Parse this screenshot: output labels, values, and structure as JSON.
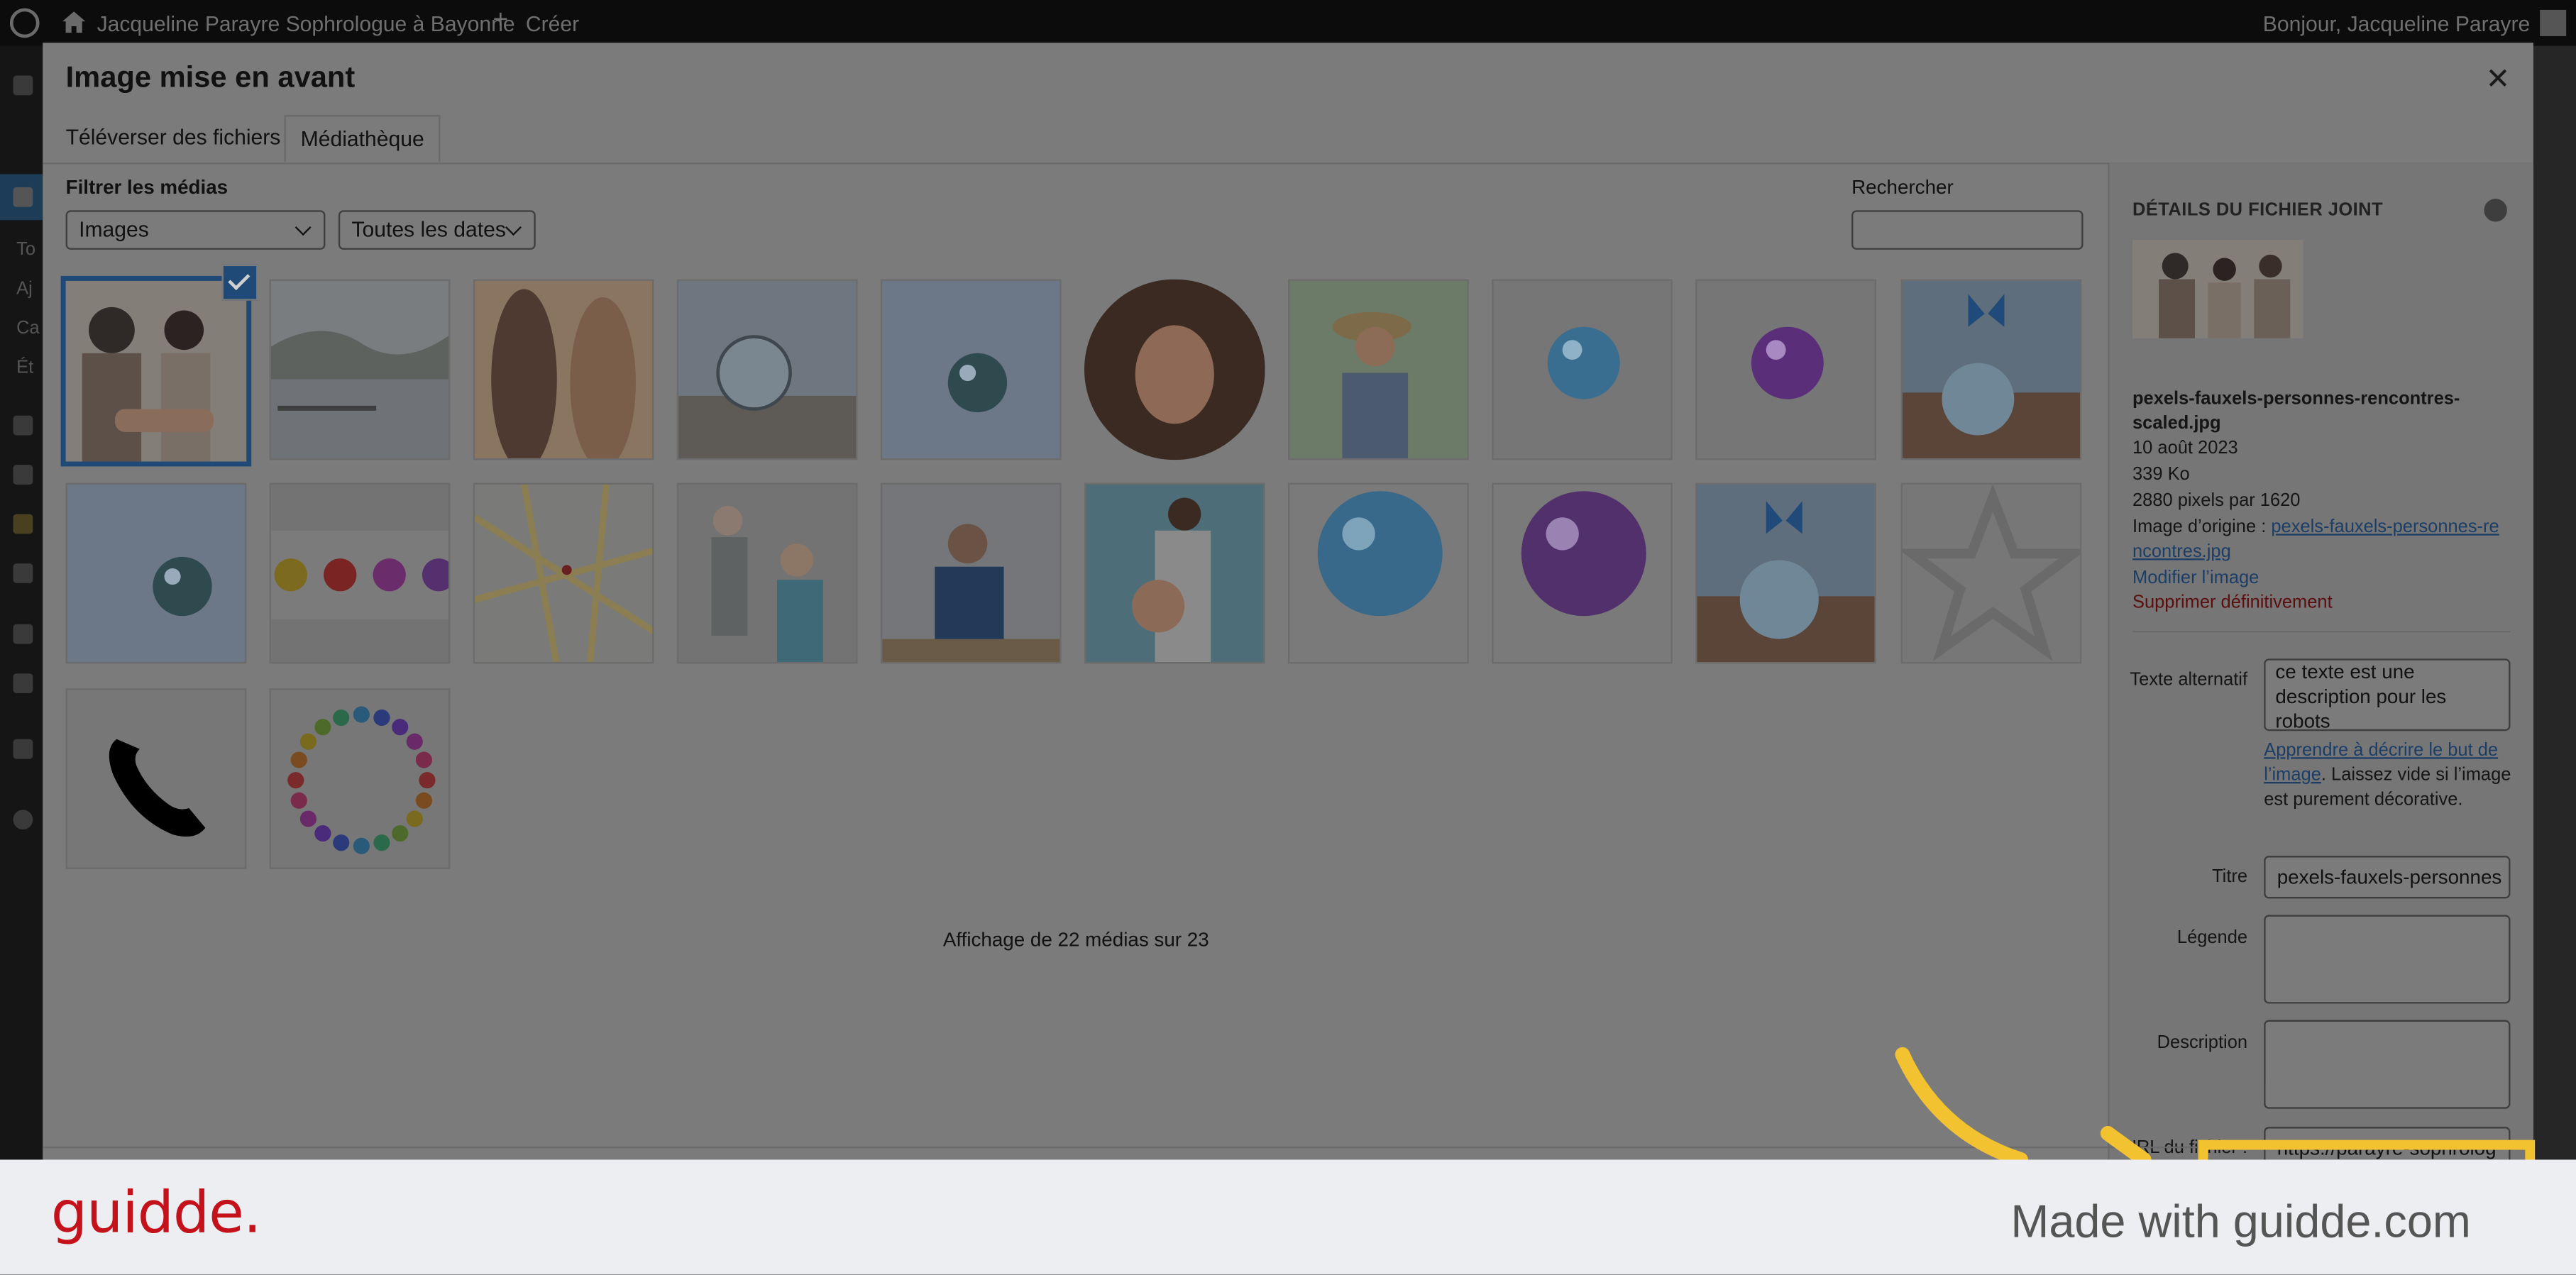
{
  "admin_bar": {
    "site_name": "Jacqueline Parayre Sophrologue à Bayonne",
    "create_label": "Créer",
    "greeting": "Bonjour, Jacqueline Parayre"
  },
  "side_menu": {
    "items": [
      "To",
      "Aj",
      "Ca",
      "Ét"
    ]
  },
  "modal": {
    "title": "Image mise en avant",
    "close_icon": "close-icon",
    "tabs": [
      {
        "label": "Téléverser des fichiers",
        "active": false
      },
      {
        "label": "Médiathèque",
        "active": true
      }
    ]
  },
  "filters": {
    "label": "Filtrer les médias",
    "type_value": "Images",
    "date_value": "Toutes les dates",
    "search_label": "Rechercher",
    "search_value": ""
  },
  "media_grid": {
    "items": [
      {
        "kind": "people-meeting",
        "selected": true
      },
      {
        "kind": "rowing-lake"
      },
      {
        "kind": "women-sunset"
      },
      {
        "kind": "crystal-ball-beach"
      },
      {
        "kind": "crystal-ball-feather"
      },
      {
        "kind": "portrait-woman"
      },
      {
        "kind": "woman-hat"
      },
      {
        "kind": "blue-bubble"
      },
      {
        "kind": "purple-bubble"
      },
      {
        "kind": "butterfly-sphere"
      },
      {
        "kind": "crystal-ball-feather-2"
      },
      {
        "kind": "bubbles-row"
      },
      {
        "kind": "street-map"
      },
      {
        "kind": "seniors-exercise"
      },
      {
        "kind": "man-relaxing"
      },
      {
        "kind": "pregnant-woman"
      },
      {
        "kind": "blue-bubble-large"
      },
      {
        "kind": "purple-bubble-large"
      },
      {
        "kind": "butterfly-sphere-2"
      },
      {
        "kind": "star-outline"
      },
      {
        "kind": "phone-icon"
      },
      {
        "kind": "color-circle"
      }
    ],
    "count_text": "Affichage de 22 médias sur 23"
  },
  "details": {
    "heading": "DÉTAILS DU FICHIER JOINT",
    "filename": "pexels-fauxels-personnes-rencontres-scaled.jpg",
    "date": "10 août 2023",
    "size": "339 Ko",
    "dimensions": "2880 pixels par 1620",
    "origin_label": "Image d’origine : ",
    "origin_link": "pexels-fauxels-personnes-rencontres.jpg",
    "edit_link": "Modifier l’image",
    "delete_link": "Supprimer définitivement",
    "alt_label": "Texte alternatif",
    "alt_value": "ce texte est une description pour les robots",
    "alt_help_link": "Apprendre à décrire le but de l’image",
    "alt_help_text": ". Laissez vide si l’image est purement décorative.",
    "title_label": "Titre",
    "title_value": "pexels-fauxels-personnes",
    "caption_label": "Légende",
    "caption_value": "",
    "description_label": "Description",
    "description_value": "",
    "url_label": "URL du fichier :",
    "url_value": "https://parayre-sophrolog"
  },
  "footer": {
    "logo": "guidde.",
    "made_with": "Made with guidde.com"
  },
  "colors": {
    "accent": "#2271b1",
    "highlight_arrow": "#f2c230",
    "brand_red": "#c4111a"
  }
}
